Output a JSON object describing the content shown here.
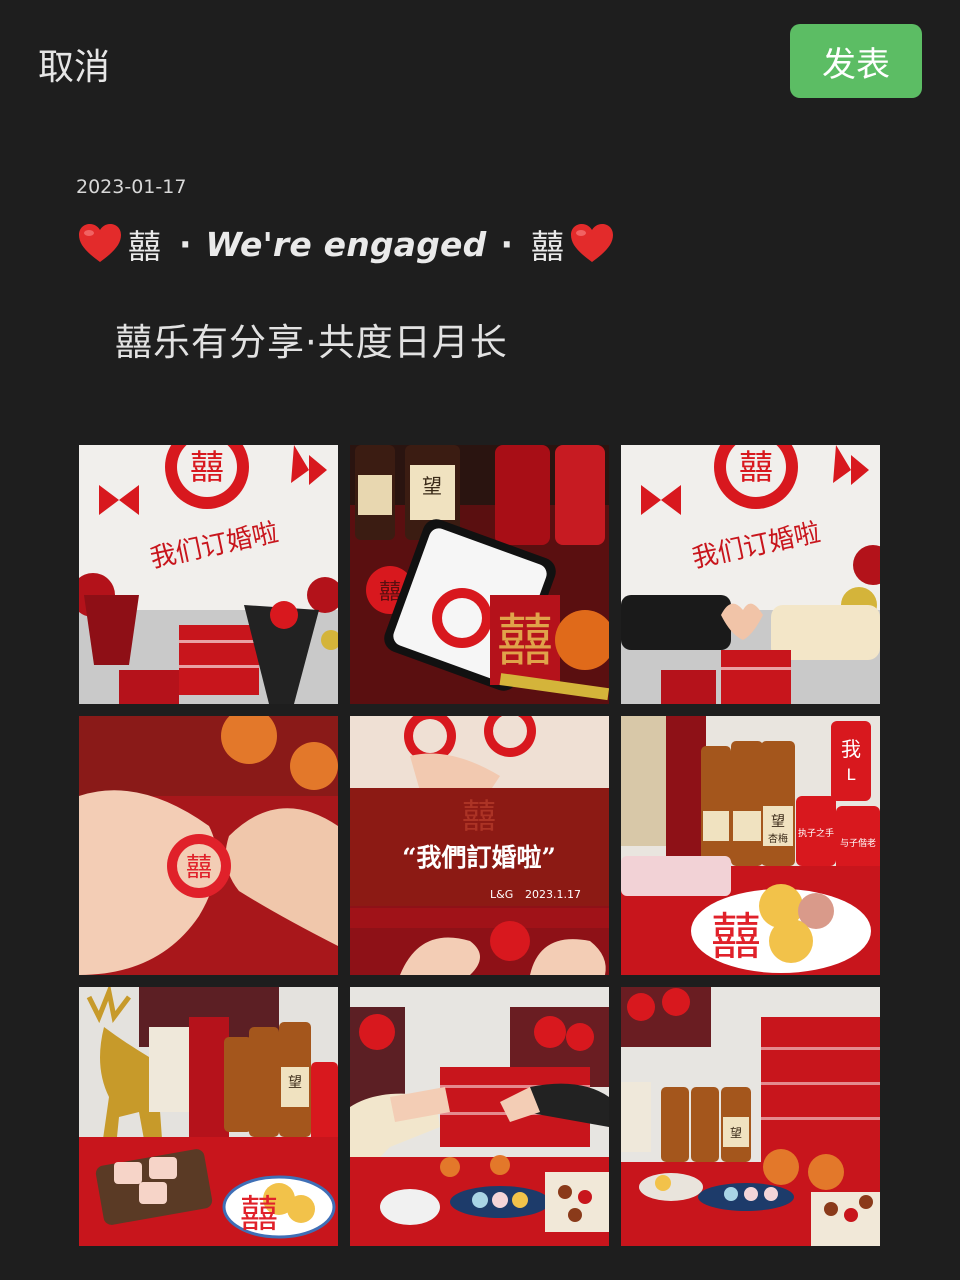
{
  "header": {
    "cancel_label": "取消",
    "publish_label": "发表"
  },
  "post": {
    "date": "2023-01-17",
    "xi_left": "囍",
    "dot_left": "·",
    "headline": "We're engaged",
    "dot_right": "·",
    "xi_right": "囍",
    "subline": "囍乐有分享·共度日月长"
  },
  "photos": {
    "banner_text": "我们订婚啦",
    "card_title": "“我們訂婚啦”",
    "card_sign": "L&G",
    "card_date": "2023.1.17",
    "xi_char": "囍",
    "bottle_label_1": "望",
    "bottle_label_2": "杏梅",
    "can_text_1": "我",
    "can_text_2": "L",
    "can_text_3": "执子之手",
    "can_text_4": "与子偕老"
  },
  "colors": {
    "background": "#1e1e1e",
    "publish_green": "#5cbd64",
    "festive_red": "#d8181e",
    "heart_red": "#e32b2b"
  }
}
